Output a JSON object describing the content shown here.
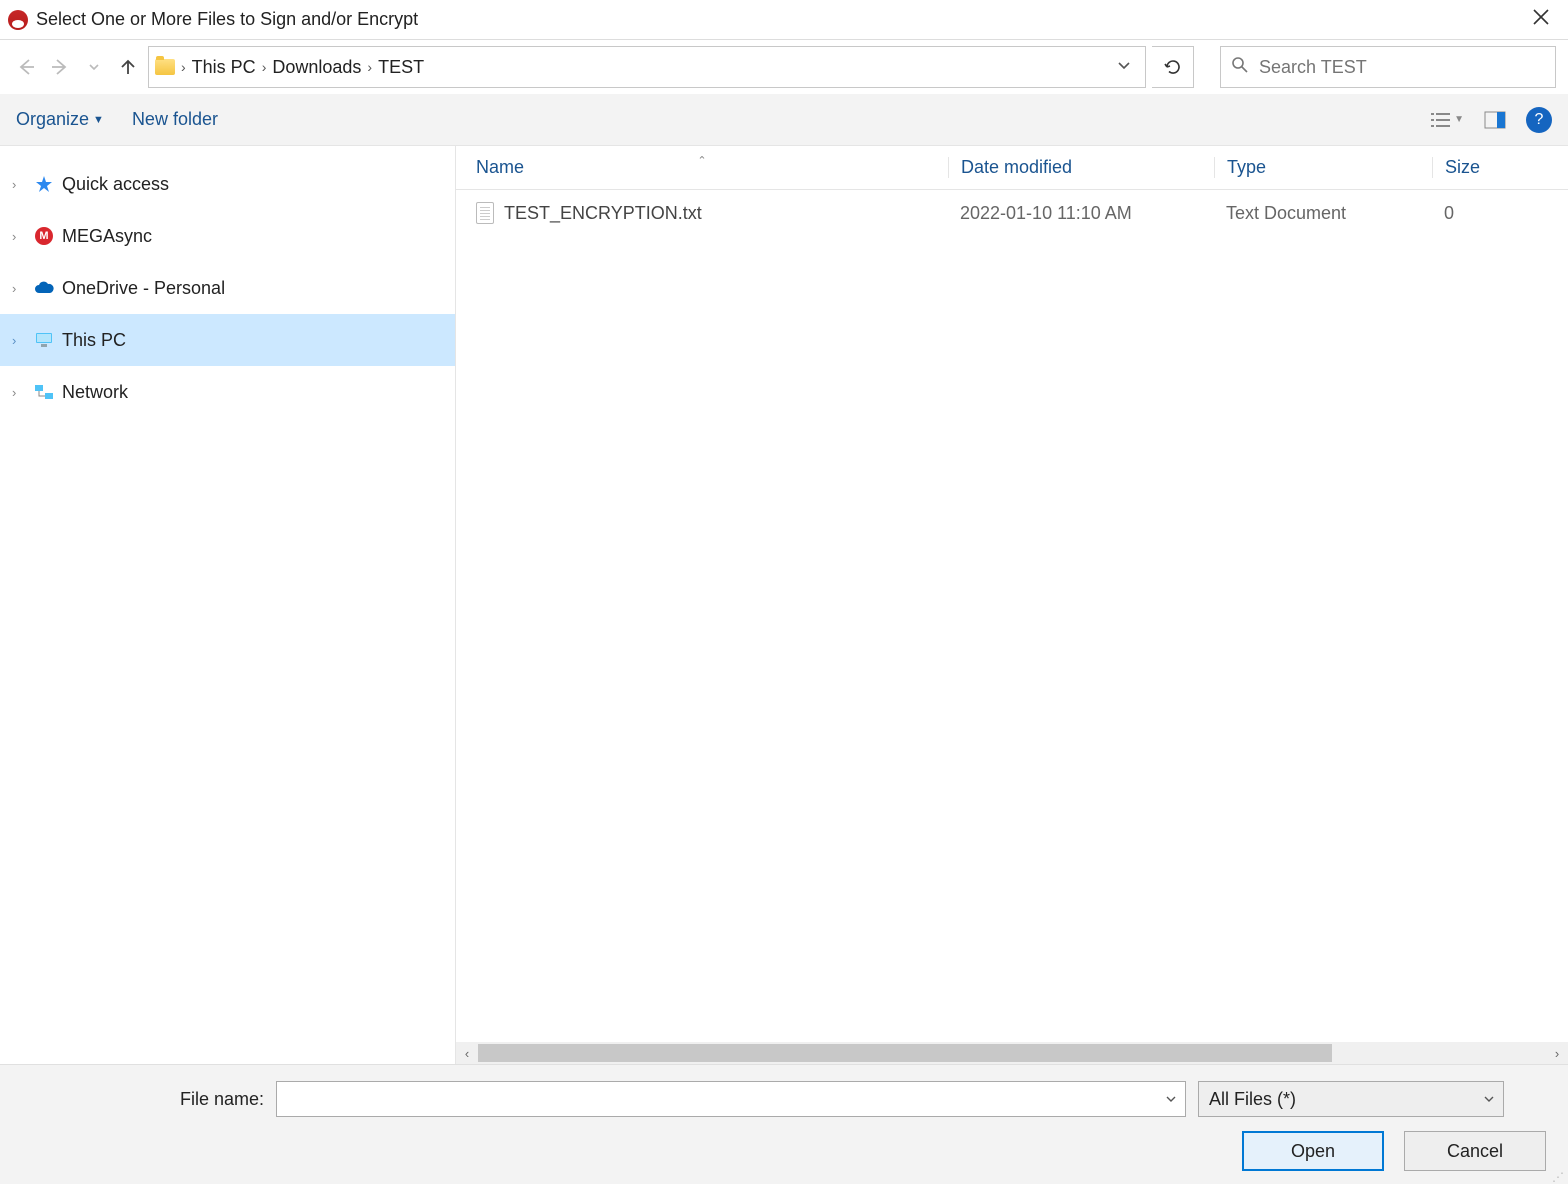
{
  "title": "Select One or More Files to Sign and/or Encrypt",
  "breadcrumb": [
    "This PC",
    "Downloads",
    "TEST"
  ],
  "search": {
    "placeholder": "Search TEST"
  },
  "toolbar": {
    "organize": "Organize",
    "newfolder": "New folder"
  },
  "sidebar": [
    {
      "label": "Quick access",
      "icon": "star",
      "selected": false
    },
    {
      "label": "MEGAsync",
      "icon": "mega",
      "selected": false
    },
    {
      "label": "OneDrive - Personal",
      "icon": "cloud",
      "selected": false
    },
    {
      "label": "This PC",
      "icon": "pc",
      "selected": true
    },
    {
      "label": "Network",
      "icon": "network",
      "selected": false
    }
  ],
  "columns": {
    "name": "Name",
    "date": "Date modified",
    "type": "Type",
    "size": "Size"
  },
  "files": [
    {
      "name": "TEST_ENCRYPTION.txt",
      "date": "2022-01-10 11:10 AM",
      "type": "Text Document",
      "size": "0"
    }
  ],
  "footer": {
    "label": "File name:",
    "filter": "All Files  (*)",
    "open": "Open",
    "cancel": "Cancel"
  }
}
